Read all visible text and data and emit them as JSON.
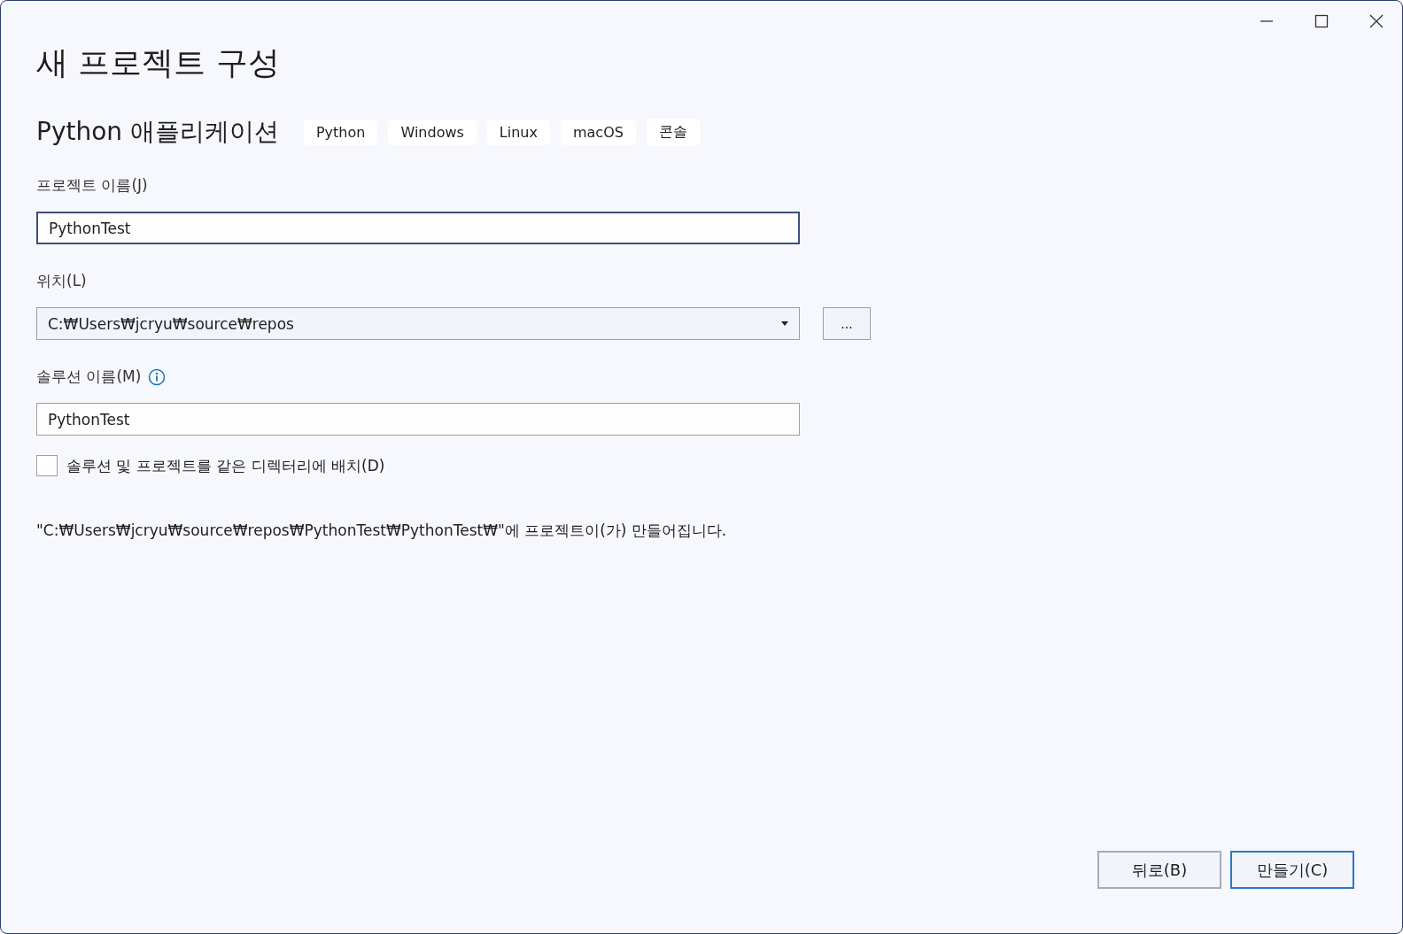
{
  "window": {
    "title": "새 프로젝트 구성"
  },
  "template": {
    "name": "Python 애플리케이션",
    "tags": [
      "Python",
      "Windows",
      "Linux",
      "macOS",
      "콘솔"
    ]
  },
  "fields": [
    {
      "kind": "text",
      "label": "프로젝트 이름(J)",
      "value": "PythonTest",
      "focused": true,
      "info": false
    },
    {
      "kind": "dropdown",
      "label": "위치(L)",
      "value": "C:₩Users₩jcryu₩source₩repos",
      "focused": false,
      "info": false,
      "browse": "..."
    },
    {
      "kind": "text",
      "label": "솔루션 이름(M)",
      "value": "PythonTest",
      "focused": false,
      "info": true
    }
  ],
  "same_directory": {
    "label": "솔루션 및 프로젝트를 같은 디렉터리에 배치(D)",
    "checked": false
  },
  "path_note": "\"C:₩Users₩jcryu₩source₩repos₩PythonTest₩PythonTest₩\"에 프로젝트이(가) 만들어집니다.",
  "buttons": [
    {
      "label": "뒤로(B)",
      "default": false
    },
    {
      "label": "만들기(C)",
      "default": true
    }
  ]
}
